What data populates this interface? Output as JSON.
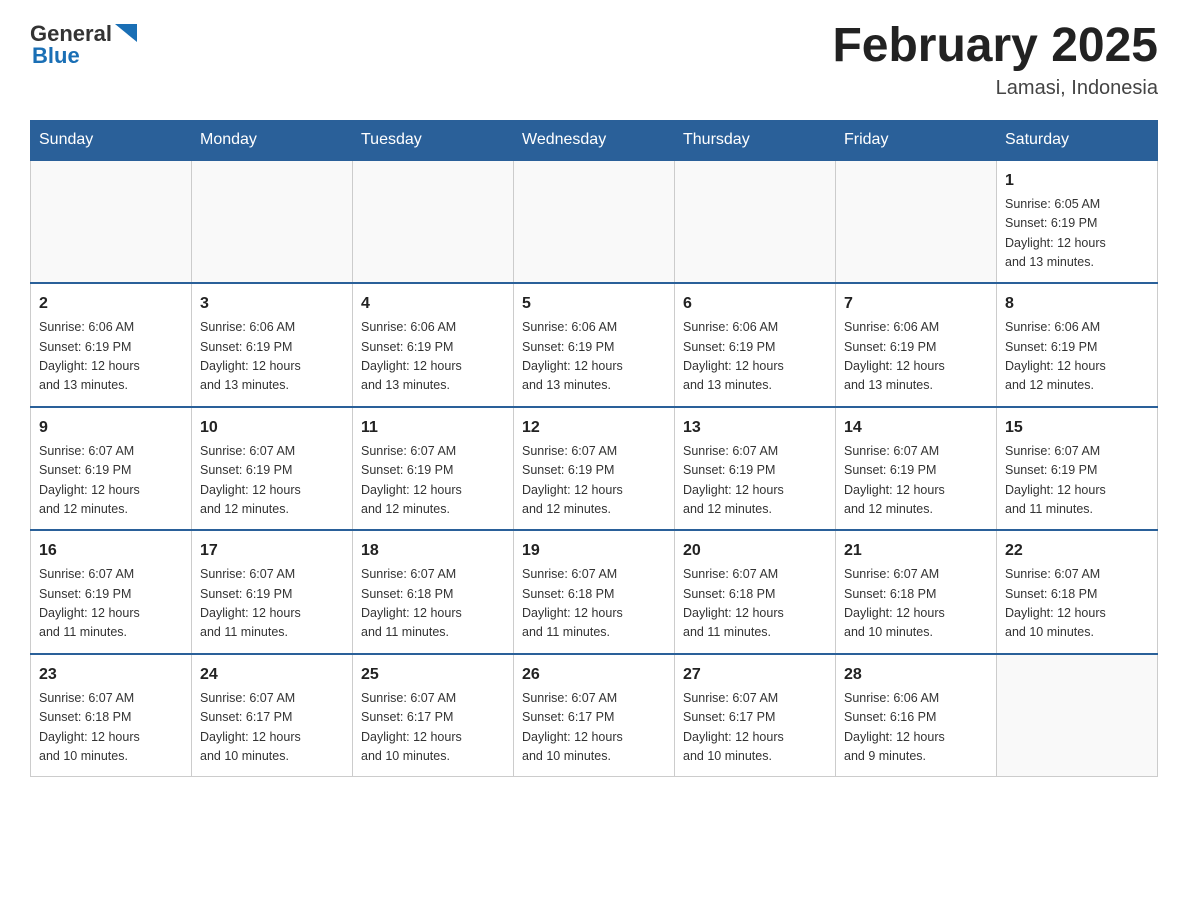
{
  "header": {
    "logo_text": "General",
    "logo_blue": "Blue",
    "month_title": "February 2025",
    "location": "Lamasi, Indonesia"
  },
  "weekdays": [
    "Sunday",
    "Monday",
    "Tuesday",
    "Wednesday",
    "Thursday",
    "Friday",
    "Saturday"
  ],
  "weeks": [
    [
      {
        "day": "",
        "info": ""
      },
      {
        "day": "",
        "info": ""
      },
      {
        "day": "",
        "info": ""
      },
      {
        "day": "",
        "info": ""
      },
      {
        "day": "",
        "info": ""
      },
      {
        "day": "",
        "info": ""
      },
      {
        "day": "1",
        "info": "Sunrise: 6:05 AM\nSunset: 6:19 PM\nDaylight: 12 hours\nand 13 minutes."
      }
    ],
    [
      {
        "day": "2",
        "info": "Sunrise: 6:06 AM\nSunset: 6:19 PM\nDaylight: 12 hours\nand 13 minutes."
      },
      {
        "day": "3",
        "info": "Sunrise: 6:06 AM\nSunset: 6:19 PM\nDaylight: 12 hours\nand 13 minutes."
      },
      {
        "day": "4",
        "info": "Sunrise: 6:06 AM\nSunset: 6:19 PM\nDaylight: 12 hours\nand 13 minutes."
      },
      {
        "day": "5",
        "info": "Sunrise: 6:06 AM\nSunset: 6:19 PM\nDaylight: 12 hours\nand 13 minutes."
      },
      {
        "day": "6",
        "info": "Sunrise: 6:06 AM\nSunset: 6:19 PM\nDaylight: 12 hours\nand 13 minutes."
      },
      {
        "day": "7",
        "info": "Sunrise: 6:06 AM\nSunset: 6:19 PM\nDaylight: 12 hours\nand 13 minutes."
      },
      {
        "day": "8",
        "info": "Sunrise: 6:06 AM\nSunset: 6:19 PM\nDaylight: 12 hours\nand 12 minutes."
      }
    ],
    [
      {
        "day": "9",
        "info": "Sunrise: 6:07 AM\nSunset: 6:19 PM\nDaylight: 12 hours\nand 12 minutes."
      },
      {
        "day": "10",
        "info": "Sunrise: 6:07 AM\nSunset: 6:19 PM\nDaylight: 12 hours\nand 12 minutes."
      },
      {
        "day": "11",
        "info": "Sunrise: 6:07 AM\nSunset: 6:19 PM\nDaylight: 12 hours\nand 12 minutes."
      },
      {
        "day": "12",
        "info": "Sunrise: 6:07 AM\nSunset: 6:19 PM\nDaylight: 12 hours\nand 12 minutes."
      },
      {
        "day": "13",
        "info": "Sunrise: 6:07 AM\nSunset: 6:19 PM\nDaylight: 12 hours\nand 12 minutes."
      },
      {
        "day": "14",
        "info": "Sunrise: 6:07 AM\nSunset: 6:19 PM\nDaylight: 12 hours\nand 12 minutes."
      },
      {
        "day": "15",
        "info": "Sunrise: 6:07 AM\nSunset: 6:19 PM\nDaylight: 12 hours\nand 11 minutes."
      }
    ],
    [
      {
        "day": "16",
        "info": "Sunrise: 6:07 AM\nSunset: 6:19 PM\nDaylight: 12 hours\nand 11 minutes."
      },
      {
        "day": "17",
        "info": "Sunrise: 6:07 AM\nSunset: 6:19 PM\nDaylight: 12 hours\nand 11 minutes."
      },
      {
        "day": "18",
        "info": "Sunrise: 6:07 AM\nSunset: 6:18 PM\nDaylight: 12 hours\nand 11 minutes."
      },
      {
        "day": "19",
        "info": "Sunrise: 6:07 AM\nSunset: 6:18 PM\nDaylight: 12 hours\nand 11 minutes."
      },
      {
        "day": "20",
        "info": "Sunrise: 6:07 AM\nSunset: 6:18 PM\nDaylight: 12 hours\nand 11 minutes."
      },
      {
        "day": "21",
        "info": "Sunrise: 6:07 AM\nSunset: 6:18 PM\nDaylight: 12 hours\nand 10 minutes."
      },
      {
        "day": "22",
        "info": "Sunrise: 6:07 AM\nSunset: 6:18 PM\nDaylight: 12 hours\nand 10 minutes."
      }
    ],
    [
      {
        "day": "23",
        "info": "Sunrise: 6:07 AM\nSunset: 6:18 PM\nDaylight: 12 hours\nand 10 minutes."
      },
      {
        "day": "24",
        "info": "Sunrise: 6:07 AM\nSunset: 6:17 PM\nDaylight: 12 hours\nand 10 minutes."
      },
      {
        "day": "25",
        "info": "Sunrise: 6:07 AM\nSunset: 6:17 PM\nDaylight: 12 hours\nand 10 minutes."
      },
      {
        "day": "26",
        "info": "Sunrise: 6:07 AM\nSunset: 6:17 PM\nDaylight: 12 hours\nand 10 minutes."
      },
      {
        "day": "27",
        "info": "Sunrise: 6:07 AM\nSunset: 6:17 PM\nDaylight: 12 hours\nand 10 minutes."
      },
      {
        "day": "28",
        "info": "Sunrise: 6:06 AM\nSunset: 6:16 PM\nDaylight: 12 hours\nand 9 minutes."
      },
      {
        "day": "",
        "info": ""
      }
    ]
  ]
}
